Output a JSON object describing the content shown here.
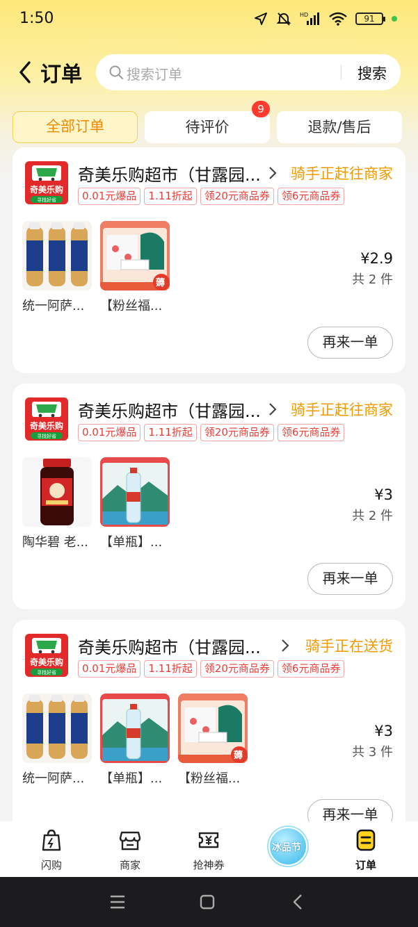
{
  "status_bar": {
    "time": "1:50",
    "battery": "91",
    "icons": [
      "location-icon",
      "mute-icon",
      "hd-signal-icon",
      "wifi-icon",
      "battery-icon"
    ]
  },
  "header": {
    "title": "订单",
    "search_placeholder": "搜索订单",
    "search_button": "搜索"
  },
  "tabs": [
    {
      "label": "全部订单",
      "active": true
    },
    {
      "label": "待评价",
      "badge": "9"
    },
    {
      "label": "退款/售后"
    }
  ],
  "orders": [
    {
      "shop": "奇美乐购超市（甘露园...",
      "status": "骑手正赶往商家",
      "tags": [
        "0.01元爆品",
        "1.11折起",
        "领20元商品券",
        "领6元商品券"
      ],
      "items": [
        {
          "name": "统一阿萨...",
          "image": "tea-bottles"
        },
        {
          "name": "【粉丝福...",
          "image": "gift-box"
        }
      ],
      "price": "¥2.9",
      "count": "共 2 件",
      "action": "再来一单"
    },
    {
      "shop": "奇美乐购超市（甘露园...",
      "status": "骑手正赶往商家",
      "tags": [
        "0.01元爆品",
        "1.11折起",
        "领20元商品券",
        "领6元商品券"
      ],
      "items": [
        {
          "name": "陶华碧 老...",
          "image": "chili-sauce"
        },
        {
          "name": "【单瓶】...",
          "image": "water-bottle"
        }
      ],
      "price": "¥3",
      "count": "共 2 件",
      "action": "再来一单"
    },
    {
      "shop": "奇美乐购超市（甘露园...",
      "status": "骑手正在送货",
      "tags": [
        "0.01元爆品",
        "1.11折起",
        "领20元商品券",
        "领6元商品券"
      ],
      "items": [
        {
          "name": "统一阿萨...",
          "image": "tea-bottles"
        },
        {
          "name": "【单瓶】...",
          "image": "water-bottle"
        },
        {
          "name": "【粉丝福...",
          "image": "gift-box"
        }
      ],
      "price": "¥3",
      "count": "共 3 件",
      "action": "再来一单"
    }
  ],
  "logo_text": {
    "main": "奇美乐购",
    "sub": "寻找好省"
  },
  "gift_stamp": "薅",
  "bottom_nav": [
    {
      "label": "闪购",
      "icon": "flash-bag-icon"
    },
    {
      "label": "商家",
      "icon": "store-icon"
    },
    {
      "label": "抢神券",
      "icon": "coupon-icon"
    },
    {
      "label": "冰品节",
      "icon": "ice-festival-icon"
    },
    {
      "label": "订单",
      "icon": "order-icon",
      "active": true
    }
  ],
  "colors": {
    "accent": "#f08a00",
    "status_orange": "#f09a00",
    "tag_red": "#e8403a",
    "header_yellow": "#fde87a",
    "badge_red": "#ff3b30"
  }
}
